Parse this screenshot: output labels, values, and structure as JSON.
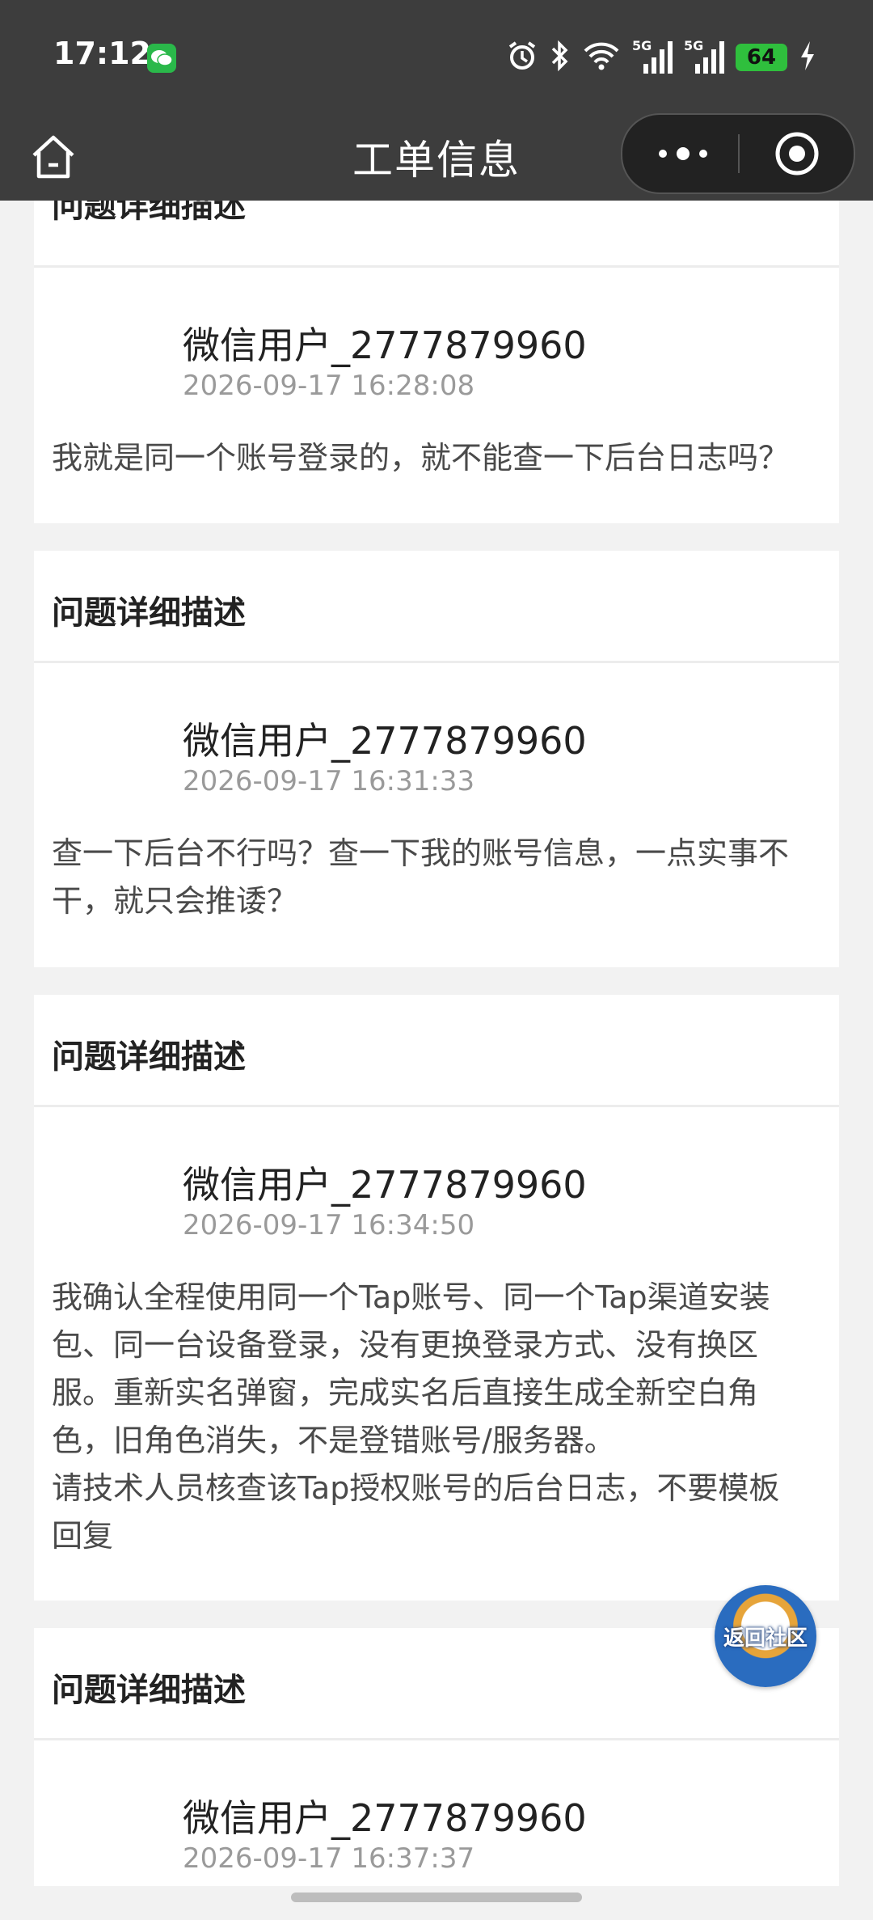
{
  "status_bar": {
    "time": "17:12",
    "network1": "5G",
    "network2": "5G",
    "battery": "64"
  },
  "nav": {
    "title": "工单信息"
  },
  "clipped_section_title": "问题详细描述",
  "entries": [
    {
      "user": "微信用户_2777879960",
      "time": "2026-09-17 16:28:08",
      "text": "我就是同一个账号登录的，就不能查一下后台日志吗？"
    },
    {
      "section_title": "问题详细描述",
      "user": "微信用户_2777879960",
      "time": "2026-09-17 16:31:33",
      "text": "查一下后台不行吗？查一下我的账号信息，一点实事不干，就只会推诿？"
    },
    {
      "section_title": "问题详细描述",
      "user": "微信用户_2777879960",
      "time": "2026-09-17 16:34:50",
      "text": "我确认全程使用同一个Tap账号、同一个Tap渠道安装包、同一台设备登录，没有更换登录方式、没有换区服。重新实名弹窗，完成实名后直接生成全新空白角色，旧角色消失，不是登错账号/服务器。\n请技术人员核查该Tap授权账号的后台日志，不要模板回复"
    },
    {
      "section_title": "问题详细描述",
      "user": "微信用户_2777879960",
      "time": "2026-09-17 16:37:37"
    }
  ],
  "float_button": {
    "label": "返回社区"
  }
}
